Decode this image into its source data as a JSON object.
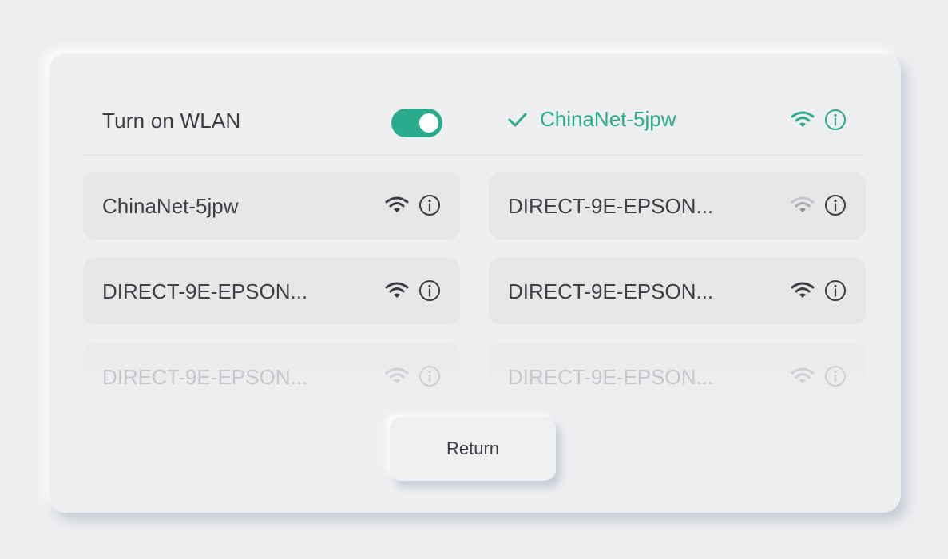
{
  "wlan": {
    "label": "Turn on WLAN",
    "enabled": true,
    "accent_color": "#2bab8d"
  },
  "connected_network": {
    "name": "ChinaNet-5jpw",
    "icon": "check-icon",
    "signal_icon": "wifi-icon",
    "info_icon": "info-icon"
  },
  "networks": [
    {
      "name": "ChinaNet-5jpw",
      "signal": "strong"
    },
    {
      "name": "DIRECT-9E-EPSON...",
      "signal": "weak"
    },
    {
      "name": "DIRECT-9E-EPSON...",
      "signal": "strong"
    },
    {
      "name": "DIRECT-9E-EPSON...",
      "signal": "strong"
    },
    {
      "name": "DIRECT-9E-EPSON...",
      "signal": "faded"
    },
    {
      "name": "DIRECT-9E-EPSON...",
      "signal": "faded"
    }
  ],
  "return_button": {
    "label": "Return"
  }
}
